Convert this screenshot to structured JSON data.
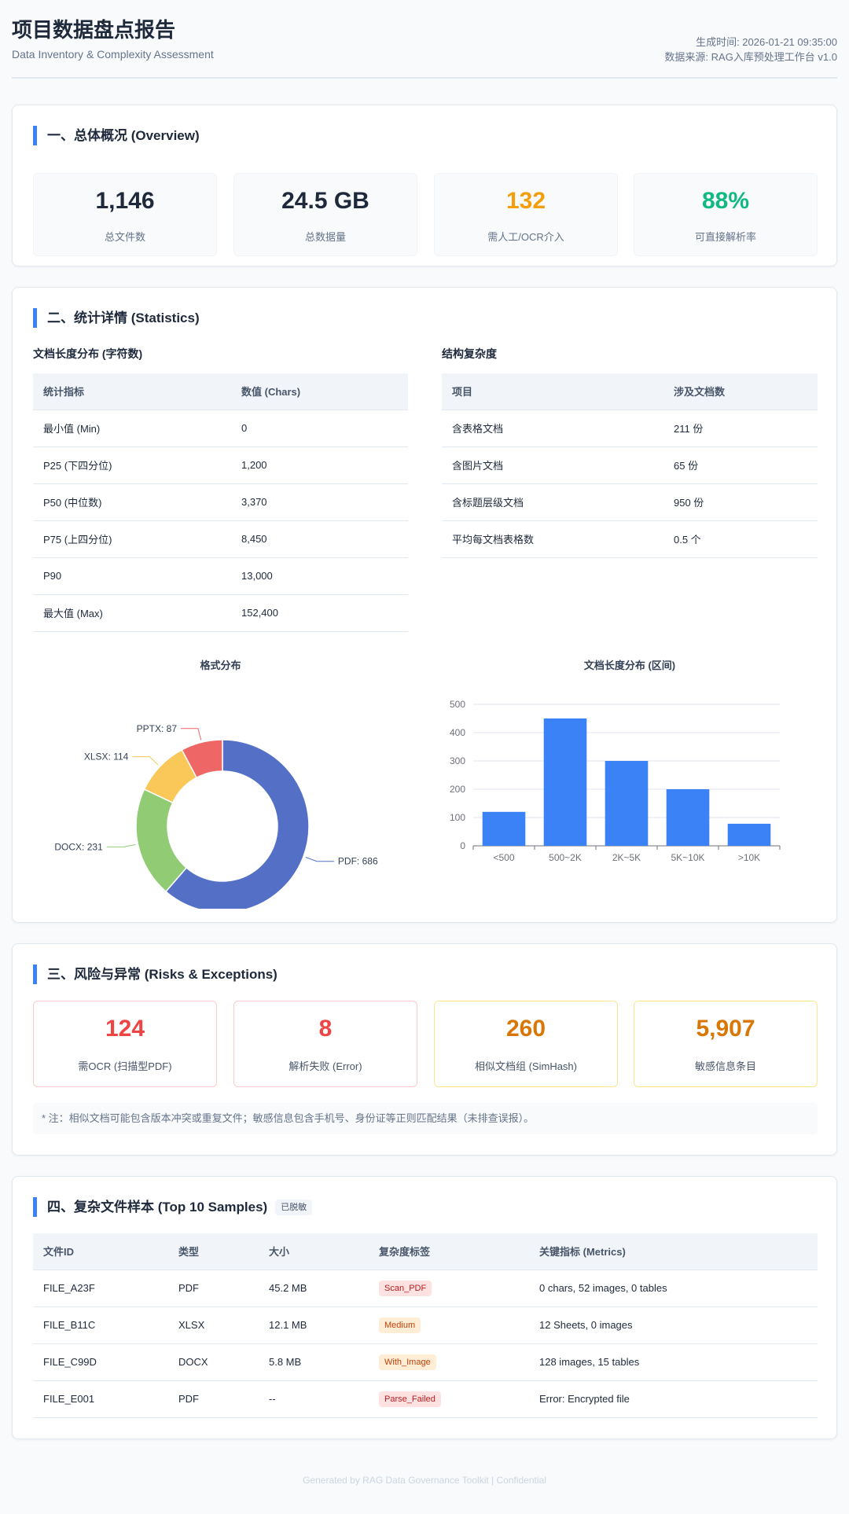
{
  "header": {
    "title": "项目数据盘点报告",
    "subtitle": "Data Inventory & Complexity Assessment",
    "generated": "生成时间: 2026-01-21 09:35:00",
    "source": "数据来源: RAG入库预处理工作台 v1.0"
  },
  "overview": {
    "title": "一、总体概况 (Overview)",
    "stats": [
      {
        "value": "1,146",
        "label": "总文件数",
        "color": "#1e293b"
      },
      {
        "value": "24.5 GB",
        "label": "总数据量",
        "color": "#1e293b"
      },
      {
        "value": "132",
        "label": "需人工/OCR介入",
        "color": "#f59e0b"
      },
      {
        "value": "88%",
        "label": "可直接解析率",
        "color": "#10b981"
      }
    ]
  },
  "statistics": {
    "title": "二、统计详情 (Statistics)",
    "length_table": {
      "title": "文档长度分布 (字符数)",
      "headers": [
        "统计指标",
        "数值 (Chars)"
      ],
      "rows": [
        [
          "最小值 (Min)",
          "0"
        ],
        [
          "P25 (下四分位)",
          "1,200"
        ],
        [
          "P50 (中位数)",
          "3,370"
        ],
        [
          "P75 (上四分位)",
          "8,450"
        ],
        [
          "P90",
          "13,000"
        ],
        [
          "最大值 (Max)",
          "152,400"
        ]
      ]
    },
    "complexity_table": {
      "title": "结构复杂度",
      "headers": [
        "项目",
        "涉及文档数"
      ],
      "rows": [
        [
          "含表格文档",
          "211 份"
        ],
        [
          "含图片文档",
          "65 份"
        ],
        [
          "含标题层级文档",
          "950 份"
        ],
        [
          "平均每文档表格数",
          "0.5 个"
        ]
      ]
    }
  },
  "chart_data": [
    {
      "type": "pie",
      "title": "格式分布",
      "categories": [
        "PDF",
        "DOCX",
        "XLSX",
        "PPTX"
      ],
      "values": [
        686,
        231,
        114,
        87
      ],
      "colors": [
        "#5470c6",
        "#91cc75",
        "#fac858",
        "#ee6666"
      ],
      "labels": [
        "PDF: 686",
        "DOCX: 231",
        "XLSX: 114",
        "PPTX: 87"
      ],
      "donut": true
    },
    {
      "type": "bar",
      "title": "文档长度分布 (区间)",
      "categories": [
        "<500",
        "500~2K",
        "2K~5K",
        "5K~10K",
        ">10K"
      ],
      "values": [
        120,
        450,
        300,
        200,
        78
      ],
      "ylim": [
        0,
        500
      ],
      "yticks": [
        "0",
        "100",
        "200",
        "300",
        "400",
        "500"
      ],
      "grid": true,
      "color": "#3b82f6"
    }
  ],
  "risks": {
    "title": "三、风险与异常 (Risks & Exceptions)",
    "items": [
      {
        "value": "124",
        "label": "需OCR (扫描型PDF)",
        "color": "#ef4444",
        "border": "#fecaca"
      },
      {
        "value": "8",
        "label": "解析失败 (Error)",
        "color": "#ef4444",
        "border": "#fecaca"
      },
      {
        "value": "260",
        "label": "相似文档组 (SimHash)",
        "color": "#d97706",
        "border": "#fde68a"
      },
      {
        "value": "5,907",
        "label": "敏感信息条目",
        "color": "#d97706",
        "border": "#fde68a"
      }
    ],
    "note": "* 注：相似文档可能包含版本冲突或重复文件；敏感信息包含手机号、身份证等正则匹配结果（未排查误报）。"
  },
  "samples": {
    "title": "四、复杂文件样本 (Top 10 Samples)",
    "badge": "已脱敏",
    "headers": [
      "文件ID",
      "类型",
      "大小",
      "复杂度标签",
      "关键指标 (Metrics)"
    ],
    "rows": [
      {
        "id": "FILE_A23F",
        "type": "PDF",
        "size": "45.2 MB",
        "tag": "Scan_PDF",
        "tag_bg": "#fee2e2",
        "tag_fg": "#b91c1c",
        "metrics": "0 chars, 52 images, 0 tables"
      },
      {
        "id": "FILE_B11C",
        "type": "XLSX",
        "size": "12.1 MB",
        "tag": "Medium",
        "tag_bg": "#ffedd5",
        "tag_fg": "#c2410c",
        "metrics": "12 Sheets, 0 images"
      },
      {
        "id": "FILE_C99D",
        "type": "DOCX",
        "size": "5.8 MB",
        "tag": "With_Image",
        "tag_bg": "#ffedd5",
        "tag_fg": "#c2410c",
        "metrics": "128 images, 15 tables"
      },
      {
        "id": "FILE_E001",
        "type": "PDF",
        "size": "--",
        "tag": "Parse_Failed",
        "tag_bg": "#fee2e2",
        "tag_fg": "#b91c1c",
        "metrics": "Error: Encrypted file"
      }
    ]
  },
  "footer": "Generated by RAG Data Governance Toolkit | Confidential"
}
